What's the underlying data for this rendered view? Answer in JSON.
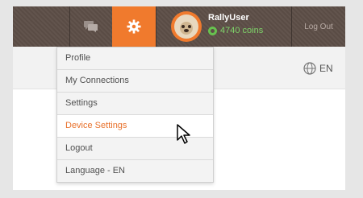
{
  "header": {
    "username": "RallyUser",
    "coins": "4740 coins",
    "logout_label": "Log Out",
    "language_label": "EN"
  },
  "menu": {
    "items": [
      {
        "label": "Profile"
      },
      {
        "label": "My Connections"
      },
      {
        "label": "Settings"
      },
      {
        "label": "Device Settings"
      },
      {
        "label": "Logout"
      },
      {
        "label": "Language - EN"
      }
    ],
    "active_item": "Device Settings"
  },
  "colors": {
    "accent": "#f07a2d",
    "topbar": "#5d4e47",
    "coins": "#7fd46a"
  },
  "icons": [
    "chat-icon",
    "gear-icon",
    "avatar",
    "coin-icon",
    "globe-icon",
    "cursor-icon"
  ]
}
